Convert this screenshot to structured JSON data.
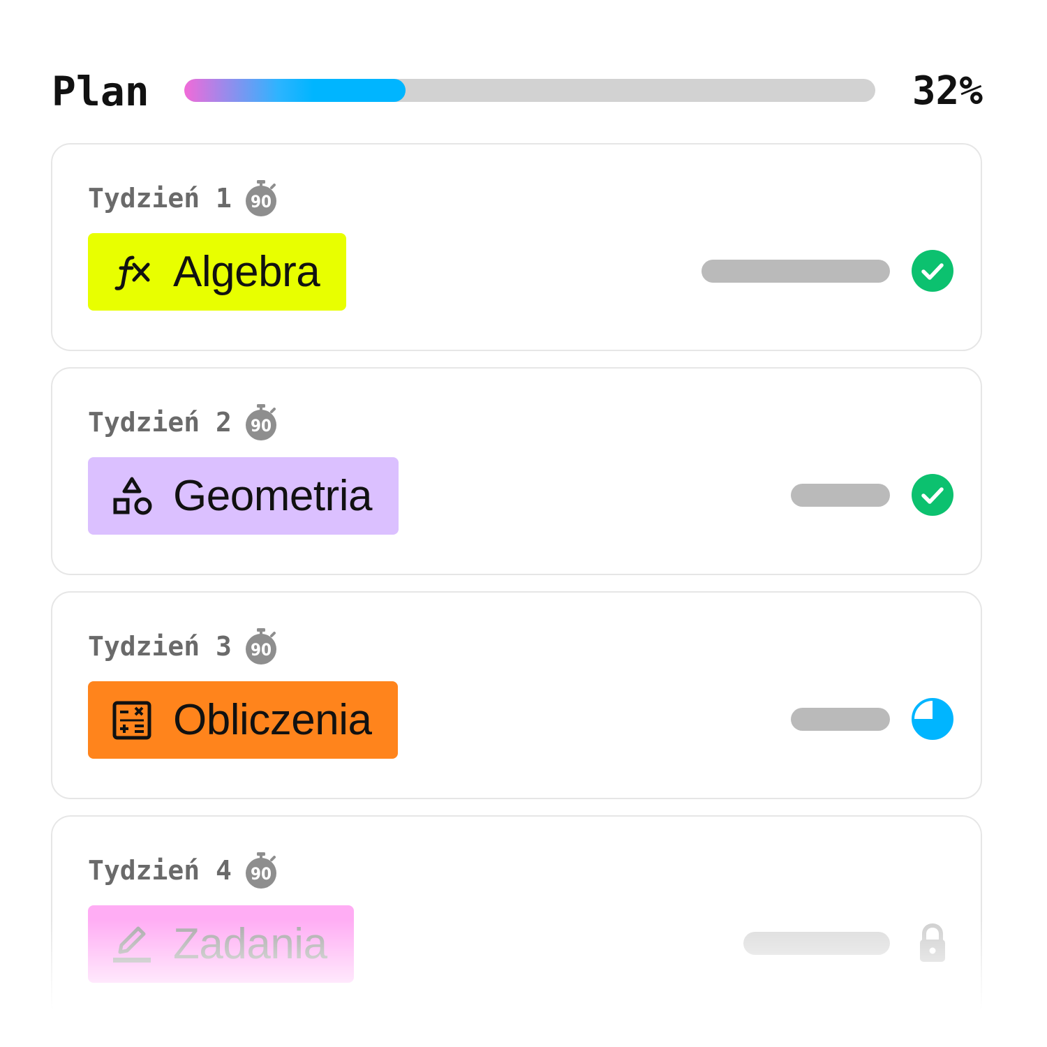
{
  "plan": {
    "title": "Plan",
    "progress_percent": 32,
    "progress_label": "32%"
  },
  "weeks": [
    {
      "label": "Tydzień 1",
      "timer_icon": "stopwatch-90-icon",
      "timer_text": "90",
      "subject": "Algebra",
      "subject_icon": "function-fx-icon",
      "subject_color": "#e8ff00",
      "status": "completed",
      "status_color": "#0cc16f"
    },
    {
      "label": "Tydzień 2",
      "timer_icon": "stopwatch-90-icon",
      "timer_text": "90",
      "subject": "Geometria",
      "subject_icon": "shapes-icon",
      "subject_color": "#dbc0ff",
      "status": "completed",
      "status_color": "#0cc16f"
    },
    {
      "label": "Tydzień 3",
      "timer_icon": "stopwatch-90-icon",
      "timer_text": "90",
      "subject": "Obliczenia",
      "subject_icon": "calculator-icon",
      "subject_color": "#ff841c",
      "status": "in-progress",
      "status_progress": 0.75,
      "status_color": "#00b5ff"
    },
    {
      "label": "Tydzień 4",
      "timer_icon": "stopwatch-90-icon",
      "timer_text": "90",
      "subject": "Zadania",
      "subject_icon": "pencil-icon",
      "subject_color": "#ff9ff3",
      "status": "locked",
      "status_color": "#d0d0d0"
    }
  ]
}
